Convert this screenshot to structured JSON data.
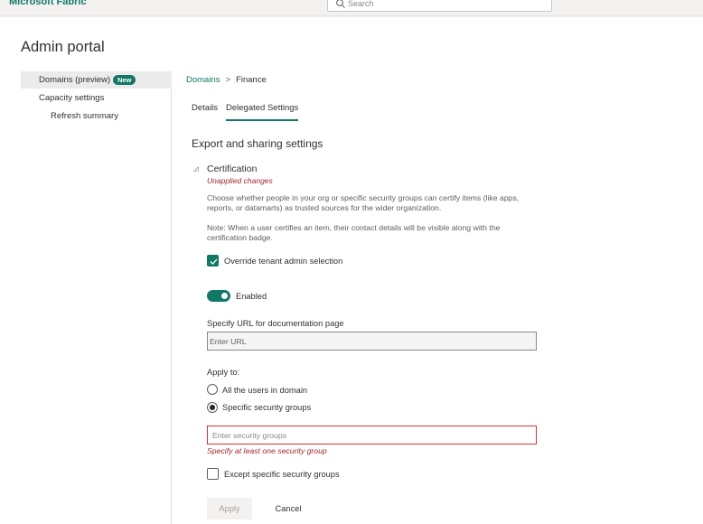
{
  "app": {
    "brand": "Microsoft Fabric",
    "search_placeholder": "Search",
    "accent_color": "#117865"
  },
  "page": {
    "title": "Admin portal"
  },
  "sidebar": {
    "items": [
      {
        "label": "Domains (preview)",
        "badge": "New",
        "selected": true
      },
      {
        "label": "Capacity settings"
      },
      {
        "label": "Refresh summary"
      }
    ]
  },
  "breadcrumb": {
    "parent": "Domains",
    "separator": ">",
    "current": "Finance"
  },
  "tabs": [
    {
      "label": "Details",
      "active": false
    },
    {
      "label": "Delegated Settings",
      "active": true
    }
  ],
  "section": {
    "title": "Export and sharing settings"
  },
  "setting": {
    "title": "Certification",
    "status": "Unapplied changes",
    "description": "Choose whether people in your org or specific security groups can certify items (like apps, reports, or datamarts) as trusted sources for the wider organization.",
    "note": "Note: When a user certifies an item, their contact details will be visible along with the certification badge.",
    "override_label": "Override tenant admin selection",
    "override_checked": true,
    "toggle_label": "Enabled",
    "toggle_on": true,
    "url_label": "Specify URL for documentation page",
    "url_placeholder": "Enter URL",
    "url_value": "",
    "apply_to_label": "Apply to:",
    "apply_options": [
      {
        "label": "All the users in domain",
        "selected": false
      },
      {
        "label": "Specific security groups",
        "selected": true
      }
    ],
    "security_groups_placeholder": "Enter security groups",
    "security_groups_error": "Specify at least one security group",
    "except_label": "Except specific security groups",
    "except_checked": false
  },
  "actions": {
    "apply_label": "Apply",
    "cancel_label": "Cancel"
  }
}
